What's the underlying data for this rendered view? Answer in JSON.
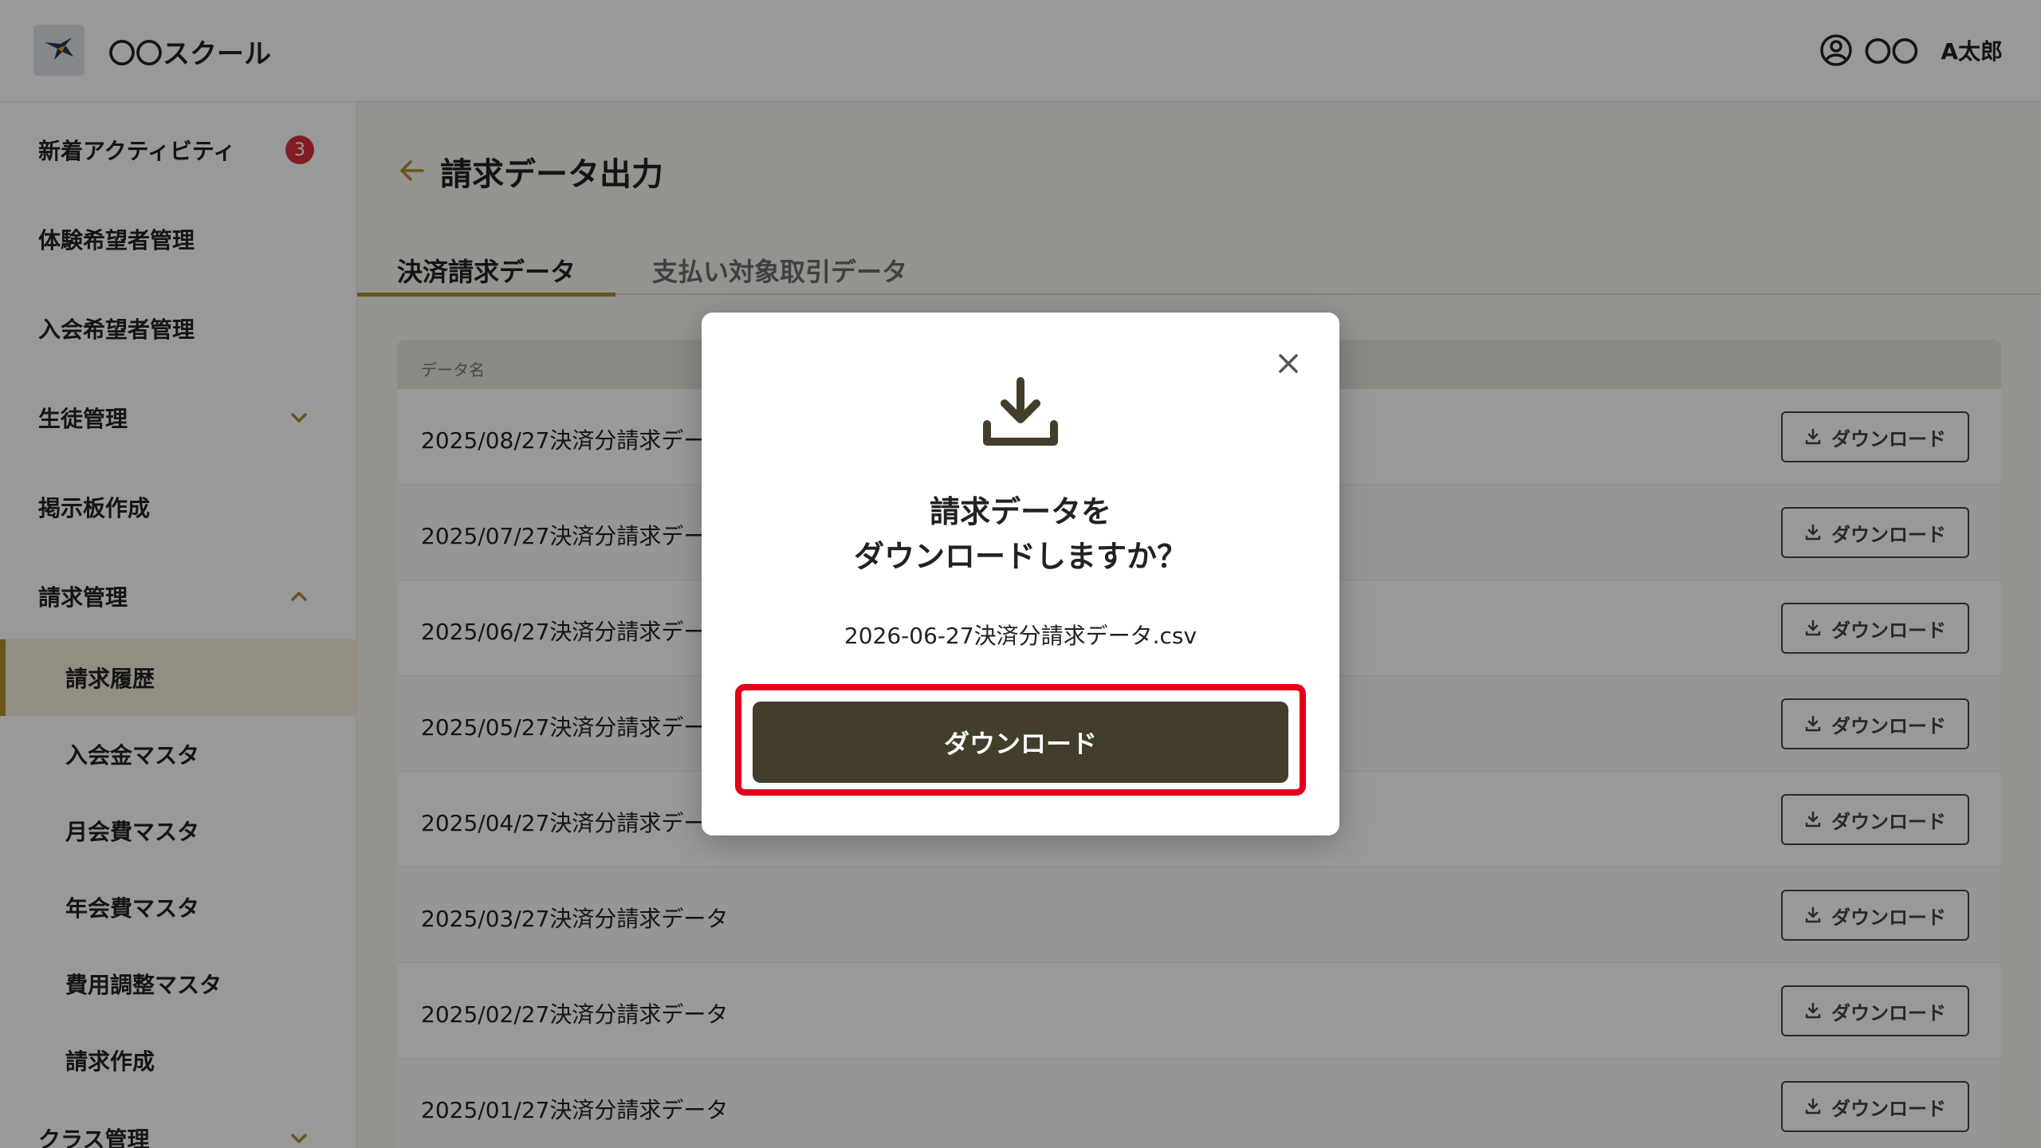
{
  "app": {
    "title": "〇〇スクール",
    "user_org": "〇〇",
    "user_name": "A太郎"
  },
  "sidebar": {
    "items": [
      {
        "label": "新着アクティビティ",
        "badge": "3"
      },
      {
        "label": "体験希望者管理"
      },
      {
        "label": "入会希望者管理"
      },
      {
        "label": "生徒管理"
      },
      {
        "label": "掲示板作成"
      },
      {
        "label": "請求管理"
      },
      {
        "label": "請求履歴"
      },
      {
        "label": "入会金マスタ"
      },
      {
        "label": "月会費マスタ"
      },
      {
        "label": "年会費マスタ"
      },
      {
        "label": "費用調整マスタ"
      },
      {
        "label": "請求作成"
      },
      {
        "label": "クラス管理"
      }
    ]
  },
  "page": {
    "title": "請求データ出力",
    "tabs": [
      "決済請求データ",
      "支払い対象取引データ"
    ]
  },
  "table": {
    "header": "データ名",
    "button_label": "ダウンロード",
    "rows": [
      "2025/08/27決済分請求データ",
      "2025/07/27決済分請求データ",
      "2025/06/27決済分請求データ",
      "2025/05/27決済分請求データ",
      "2025/04/27決済分請求データ",
      "2025/03/27決済分請求データ",
      "2025/02/27決済分請求データ",
      "2025/01/27決済分請求データ"
    ]
  },
  "modal": {
    "message_line1": "請求データを",
    "message_line2": "ダウンロードしますか？",
    "filename": "2026-06-27決済分請求データ.csv",
    "confirm_label": "ダウンロード"
  },
  "colors": {
    "accent": "#b08c2b",
    "primary_button": "#423e2b",
    "badge": "#d6313d",
    "highlight": "#e4001b"
  }
}
